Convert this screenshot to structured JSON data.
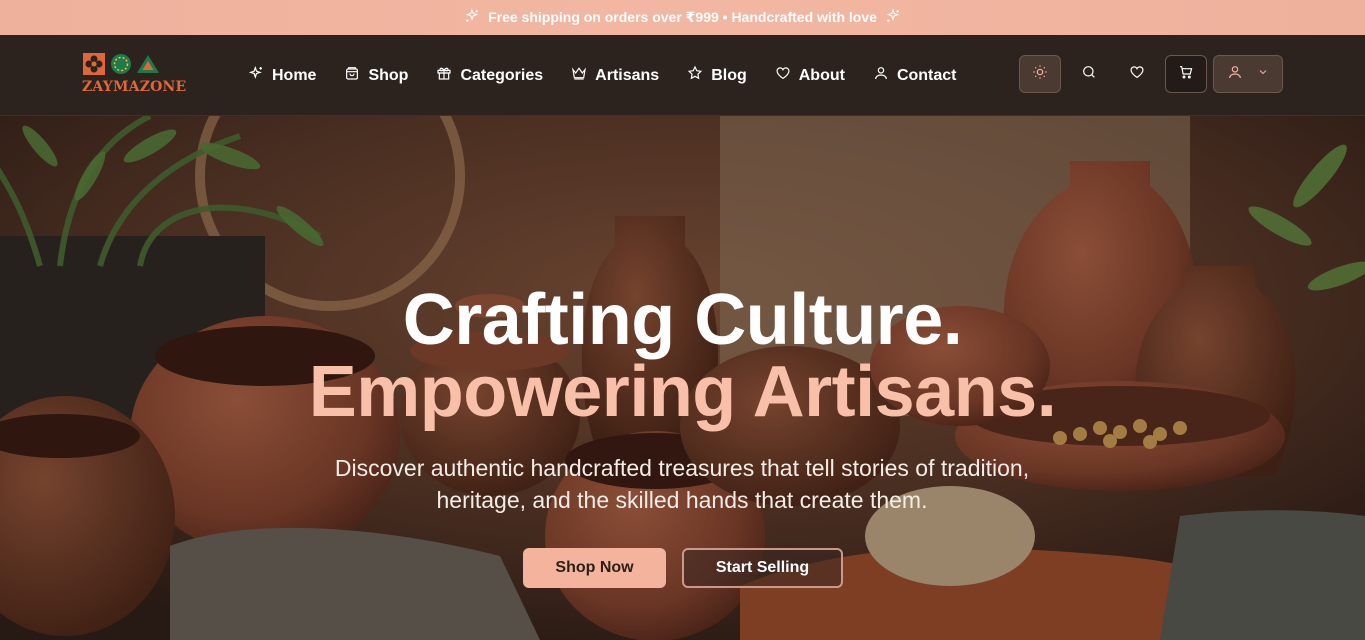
{
  "announcement": {
    "text": "Free shipping on orders over ₹999 • Handcrafted with love",
    "icon_left": "sparkles-icon",
    "icon_right": "sparkles-icon"
  },
  "brand": {
    "logo_text": "ZAYMAZONE",
    "colors": {
      "accent": "#f4b39c",
      "brand": "#e0673a",
      "header_bg": "#2c231e"
    }
  },
  "nav": {
    "items": [
      {
        "label": "Home",
        "icon": "sparkles-icon"
      },
      {
        "label": "Shop",
        "icon": "shopping-bag-icon"
      },
      {
        "label": "Categories",
        "icon": "gift-icon"
      },
      {
        "label": "Artisans",
        "icon": "crown-icon"
      },
      {
        "label": "Blog",
        "icon": "star-icon"
      },
      {
        "label": "About",
        "icon": "heart-icon"
      },
      {
        "label": "Contact",
        "icon": "user-icon"
      }
    ]
  },
  "actions": {
    "theme": "sun-icon",
    "search": "search-icon",
    "wishlist": "heart-icon",
    "cart": "cart-icon",
    "account": "user-icon",
    "account_menu": "chevron-down-icon"
  },
  "hero": {
    "title_line1": "Crafting Culture.",
    "title_line2": "Empowering Artisans.",
    "subtitle": "Discover authentic handcrafted treasures that tell stories of tradition, heritage, and the skilled hands that create them.",
    "primary_cta": "Shop Now",
    "secondary_cta": "Start Selling"
  }
}
